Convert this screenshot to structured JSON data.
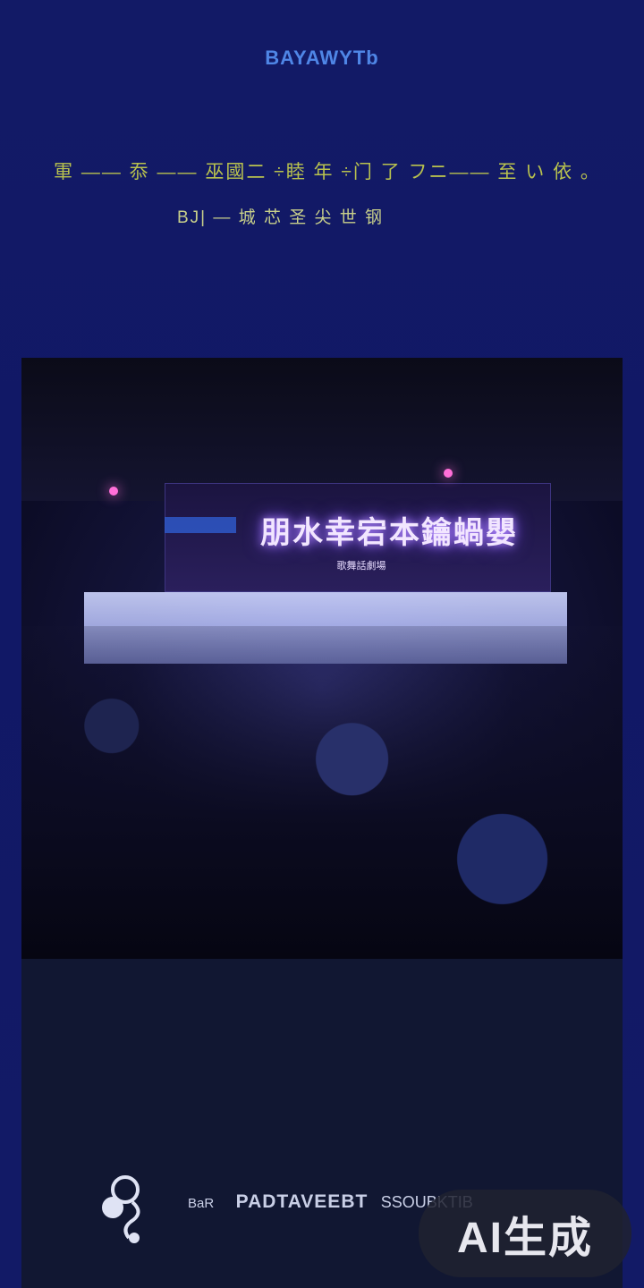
{
  "brand": "BAYAWYTb",
  "headline": "軍 —— 忝 —— 巫國二 ÷睦 年 ÷门 了 フニ—— 至 い 依 。",
  "subline": "BJ| — 城 芯 圣 尖 世 钢",
  "photo": {
    "screen_text": "朋水幸宕本鑰蝸嬰",
    "small_sign": "歌舞話劇場"
  },
  "footer": {
    "small_label": "BaR",
    "main_label": "PADTAVEEBT",
    "tail_label": "SSOUBKTIB"
  },
  "badge": {
    "label": "AI生成"
  }
}
